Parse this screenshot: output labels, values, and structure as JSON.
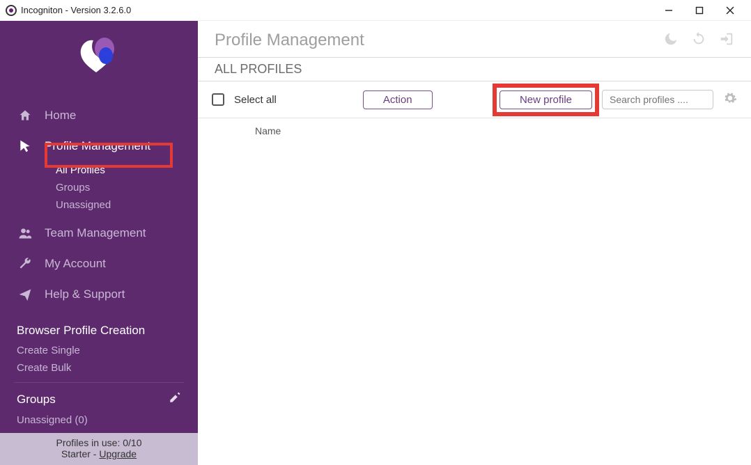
{
  "window": {
    "title": "Incogniton - Version 3.2.6.0"
  },
  "sidebar": {
    "nav": [
      {
        "label": "Home"
      },
      {
        "label": "Profile Management"
      },
      {
        "label": "Team Management"
      },
      {
        "label": "My Account"
      },
      {
        "label": "Help & Support"
      }
    ],
    "profile_sub": [
      {
        "label": "All Profiles"
      },
      {
        "label": "Groups"
      },
      {
        "label": "Unassigned"
      }
    ],
    "creation_header": "Browser Profile Creation",
    "creation_links": [
      {
        "label": "Create Single"
      },
      {
        "label": "Create Bulk"
      }
    ],
    "groups_header": "Groups",
    "groups_items": [
      {
        "label": "Unassigned (0)"
      }
    ],
    "footer": {
      "line1_prefix": "Profiles in use:  ",
      "line1_value": "0/10",
      "line2_prefix": "Starter - ",
      "line2_link": "Upgrade"
    }
  },
  "main": {
    "title": "Profile Management",
    "subheader": "ALL PROFILES",
    "toolbar": {
      "select_all": "Select all",
      "action": "Action",
      "new_profile": "New profile",
      "search_placeholder": "Search profiles ...."
    },
    "columns": {
      "name": "Name"
    }
  }
}
